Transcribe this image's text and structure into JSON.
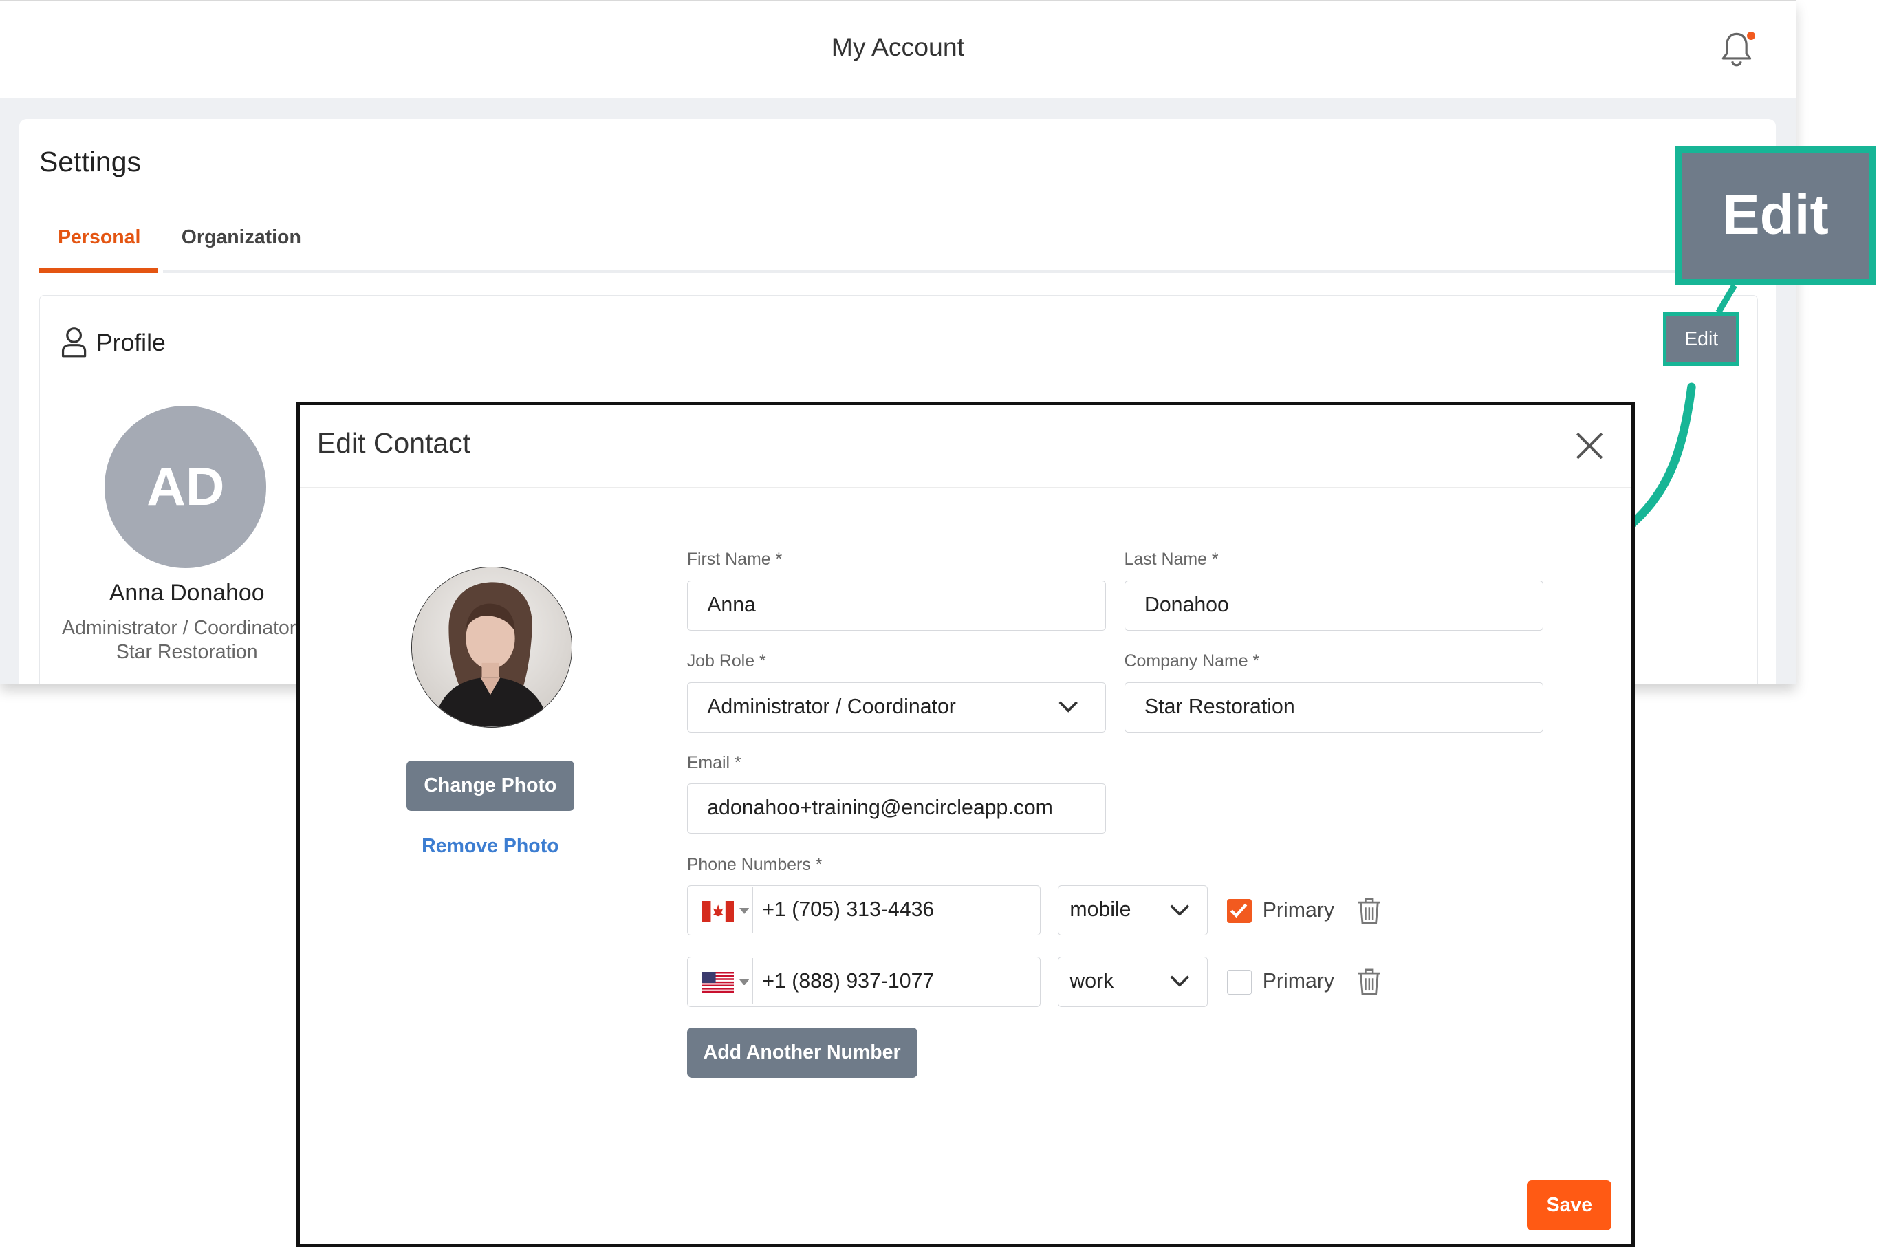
{
  "topbar": {
    "title": "My Account"
  },
  "settings": {
    "title": "Settings",
    "tabs": [
      {
        "label": "Personal",
        "active": true
      },
      {
        "label": "Organization",
        "active": false
      }
    ]
  },
  "profile": {
    "title": "Profile",
    "edit_label": "Edit",
    "initials": "AD",
    "name": "Anna Donahoo",
    "role": "Administrator / Coordinator",
    "company": "Star Restoration"
  },
  "callout": {
    "label": "Edit"
  },
  "modal": {
    "title": "Edit Contact",
    "change_photo": "Change Photo",
    "remove_photo": "Remove Photo",
    "first_name": {
      "label": "First Name *",
      "value": "Anna"
    },
    "last_name": {
      "label": "Last Name *",
      "value": "Donahoo"
    },
    "job_role": {
      "label": "Job Role *",
      "value": "Administrator / Coordinator"
    },
    "company_name": {
      "label": "Company Name *",
      "value": "Star Restoration"
    },
    "email": {
      "label": "Email *",
      "value": "adonahoo+training@encircleapp.com"
    },
    "phones": {
      "label": "Phone Numbers *",
      "items": [
        {
          "flag": "canada-flag-icon",
          "number": "+1 (705) 313-4436",
          "type": "mobile",
          "primary_label": "Primary",
          "primary": true
        },
        {
          "flag": "usa-flag-icon",
          "number": "+1 (888) 937-1077",
          "type": "work",
          "primary_label": "Primary",
          "primary": false
        }
      ]
    },
    "add_number": "Add Another Number",
    "save": "Save"
  },
  "colors": {
    "accent": "#e45512",
    "save": "#ff5a14",
    "button_gray": "#6f7b89",
    "callout_teal": "#17b596",
    "link": "#3c7dd1"
  }
}
